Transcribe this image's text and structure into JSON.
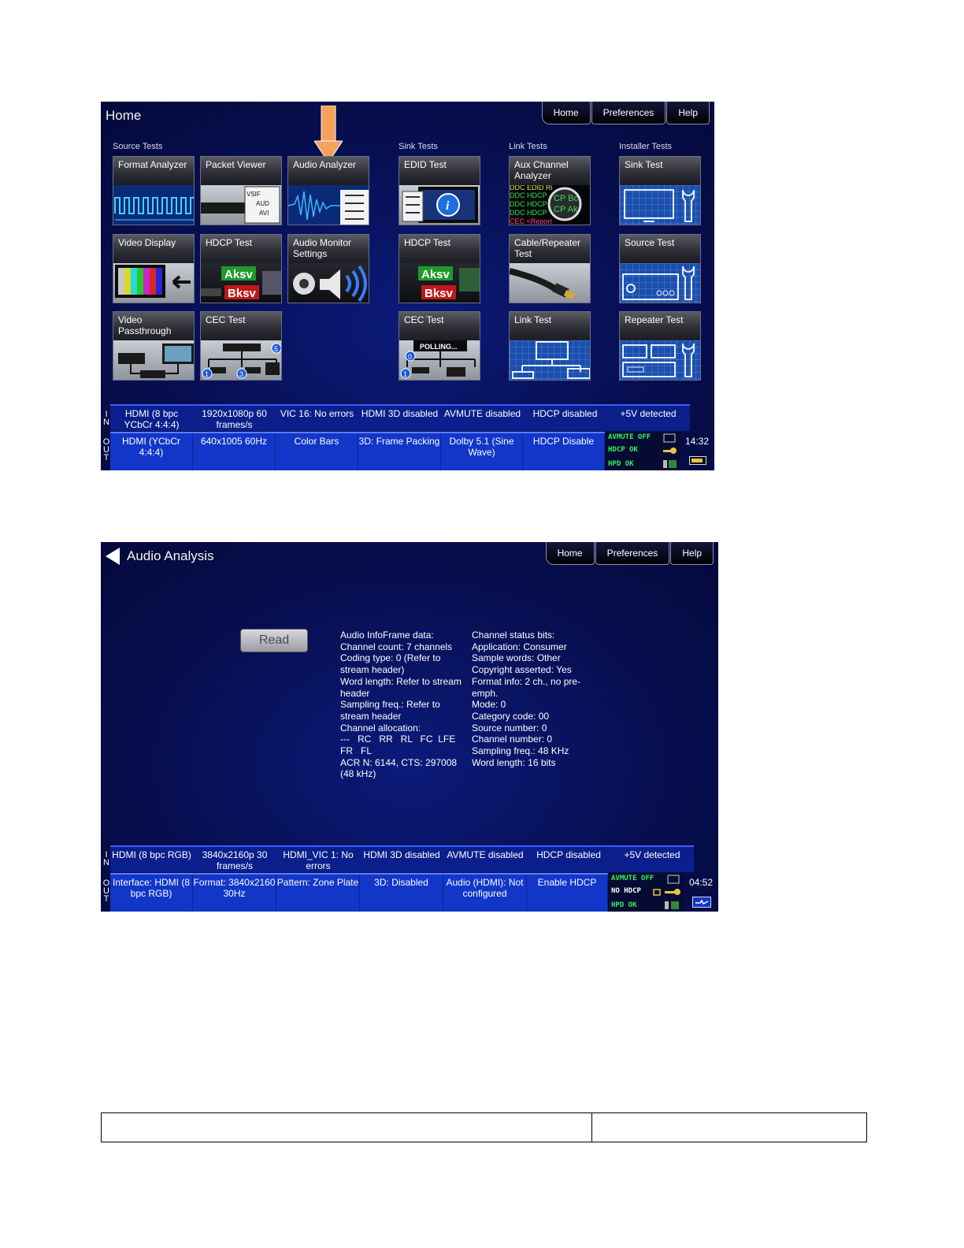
{
  "screen1": {
    "title": "Home",
    "nav": [
      "Home",
      "Preferences",
      "Help"
    ],
    "sections": [
      "Source Tests",
      "Sink Tests",
      "Link Tests",
      "Installer Tests"
    ],
    "tiles": [
      {
        "label": "Format Analyzer",
        "icon": "waveform-icon"
      },
      {
        "label": "Packet Viewer",
        "icon": "packet-viewer-icon"
      },
      {
        "label": "Audio Analyzer",
        "icon": "audio-waveform-icon"
      },
      {
        "label": "EDID Test",
        "icon": "edid-info-icon"
      },
      {
        "label": "Aux Channel Analyzer",
        "icon": "aux-channel-magnifier-icon",
        "image_text": [
          "DDC EDID Ri",
          "DDC HDCP",
          "DDC HDCP",
          "DDC HDCP",
          "CEC <Report",
          "CP Bc",
          "CP Ak"
        ]
      },
      {
        "label": "Sink Test",
        "icon": "sink-monitor-icon"
      },
      {
        "label": "Video Display",
        "icon": "color-bars-monitor-icon"
      },
      {
        "label": "HDCP Test",
        "icon": "hdcp-keys-icon",
        "image_text": [
          "Aksv",
          "Bksv"
        ]
      },
      {
        "label": "Audio Monitor Settings",
        "icon": "audio-settings-icon"
      },
      {
        "label": "HDCP Test",
        "icon": "hdcp-keys-icon",
        "image_text": [
          "Aksv",
          "Bksv"
        ]
      },
      {
        "label": "Cable/Repeater Test",
        "icon": "hdmi-cable-icon"
      },
      {
        "label": "Source Test",
        "icon": "source-receiver-icon"
      },
      {
        "label": "Video Passthrough",
        "icon": "video-passthrough-icon"
      },
      {
        "label": "CEC Test",
        "icon": "cec-devices-icon",
        "image_text": [
          "1",
          "3",
          "5"
        ]
      },
      {
        "label": "CEC Test",
        "icon": "cec-polling-icon",
        "image_text": [
          "POLLING...",
          "0",
          "1"
        ]
      },
      {
        "label": "Link Test",
        "icon": "link-test-icon"
      },
      {
        "label": "Repeater Test",
        "icon": "repeater-icon"
      }
    ],
    "in_label": "IN",
    "out_label": "OUT",
    "in_status": [
      "HDMI (8 bpc YCbCr 4:4:4)",
      "1920x1080p 60 frames/s",
      "VIC 16: No errors",
      "HDMI 3D disabled",
      "AVMUTE disabled",
      "HDCP disabled",
      "+5V detected"
    ],
    "out_status": [
      "HDMI (YCbCr 4:4:4)",
      "640x1005 60Hz",
      "Color Bars",
      "3D: Frame Packing",
      "Dolby 5.1 (Sine Wave)",
      "HDCP Disable"
    ],
    "indicators": [
      "AVMUTE OFF",
      "HDCP OK",
      "HPD OK"
    ],
    "time": "14:32"
  },
  "screen2": {
    "title": "Audio Analysis",
    "nav": [
      "Home",
      "Preferences",
      "Help"
    ],
    "read_button": "Read",
    "infoframe_lines": [
      "Audio InfoFrame data:",
      "Channel count: 7 channels",
      "Coding type: 0 (Refer to",
      "stream header)",
      "Word length: Refer to stream",
      "header",
      "Sampling freq.: Refer to",
      "stream header",
      "Channel allocation:",
      "---   RC   RR   RL   FC  LFE",
      "FR   FL",
      "ACR N: 6144, CTS: 297008",
      "(48 kHz)"
    ],
    "channel_status_lines": [
      "Channel status bits:",
      "Application: Consumer",
      "Sample words: Other",
      "Copyright asserted: Yes",
      "Format info: 2 ch., no pre-",
      "emph.",
      "Mode: 0",
      "Category code: 00",
      "Source number: 0",
      "Channel number: 0",
      "Sampling freq.: 48 KHz",
      "Word length: 16 bits"
    ],
    "in_label": "IN",
    "out_label": "OUT",
    "in_status": [
      "HDMI (8 bpc RGB)",
      "3840x2160p 30 frames/s",
      "HDMI_VIC 1: No errors",
      "HDMI 3D disabled",
      "AVMUTE disabled",
      "HDCP disabled",
      "+5V detected"
    ],
    "out_status": [
      "Interface: HDMI (8 bpc RGB)",
      "Format: 3840x2160 30Hz",
      "Pattern: Zone Plate",
      "3D: Disabled",
      "Audio (HDMI): Not configured",
      "Enable HDCP"
    ],
    "indicators": [
      "AVMUTE OFF",
      "NO HDCP",
      "HPD OK"
    ],
    "time": "04:52"
  },
  "colors": {
    "screen_bg": "#070f52",
    "in_bar": "#0a1f8c",
    "out_bar": "#1236c8",
    "indicator_green": "#35f25a",
    "arrow_orange": "#f5a25a"
  }
}
